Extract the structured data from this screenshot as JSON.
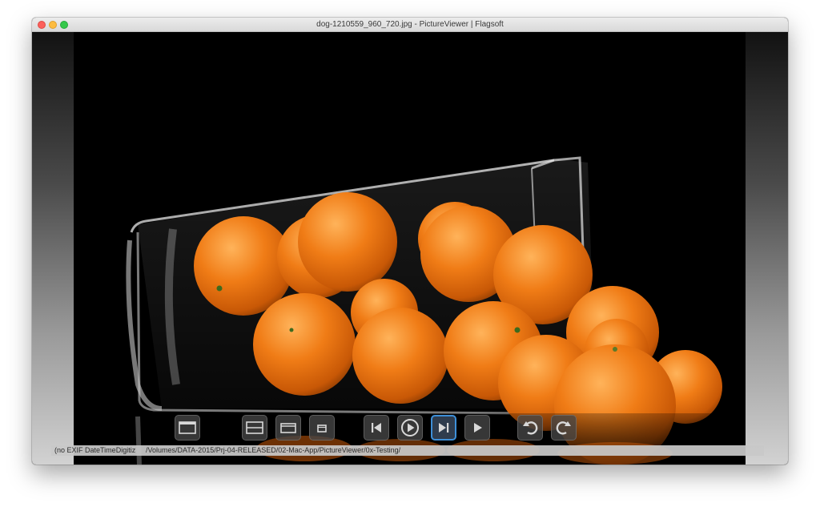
{
  "window": {
    "title": "dog-1210559_960_720.jpg - PictureViewer | Flagsoft"
  },
  "photo": {
    "subject": "tangerines in a tilted glass vase on black background"
  },
  "toolbar": {
    "buttons": [
      {
        "name": "open-folder-button",
        "icon": "folder-icon"
      },
      {
        "name": "view-mode-1-button",
        "icon": "window-large-icon"
      },
      {
        "name": "view-mode-2-button",
        "icon": "window-medium-icon"
      },
      {
        "name": "view-mode-3-button",
        "icon": "window-small-icon"
      },
      {
        "name": "first-image-button",
        "icon": "skip-back-icon"
      },
      {
        "name": "play-slideshow-button",
        "icon": "play-circle-icon"
      },
      {
        "name": "next-image-button",
        "icon": "skip-forward-icon"
      },
      {
        "name": "play-button",
        "icon": "play-icon"
      },
      {
        "name": "rotate-left-button",
        "icon": "rotate-left-icon"
      },
      {
        "name": "rotate-right-button",
        "icon": "rotate-right-icon"
      }
    ]
  },
  "status": {
    "exif": "(no EXIF DateTimeDigitiz",
    "path": "/Volumes/DATA-2015/Prj-04-RELEASED/02-Mac-App/PictureViewer/0x-Testing/"
  },
  "colors": {
    "selection_border": "#3d8fd8",
    "orange": "#ee7a14"
  }
}
